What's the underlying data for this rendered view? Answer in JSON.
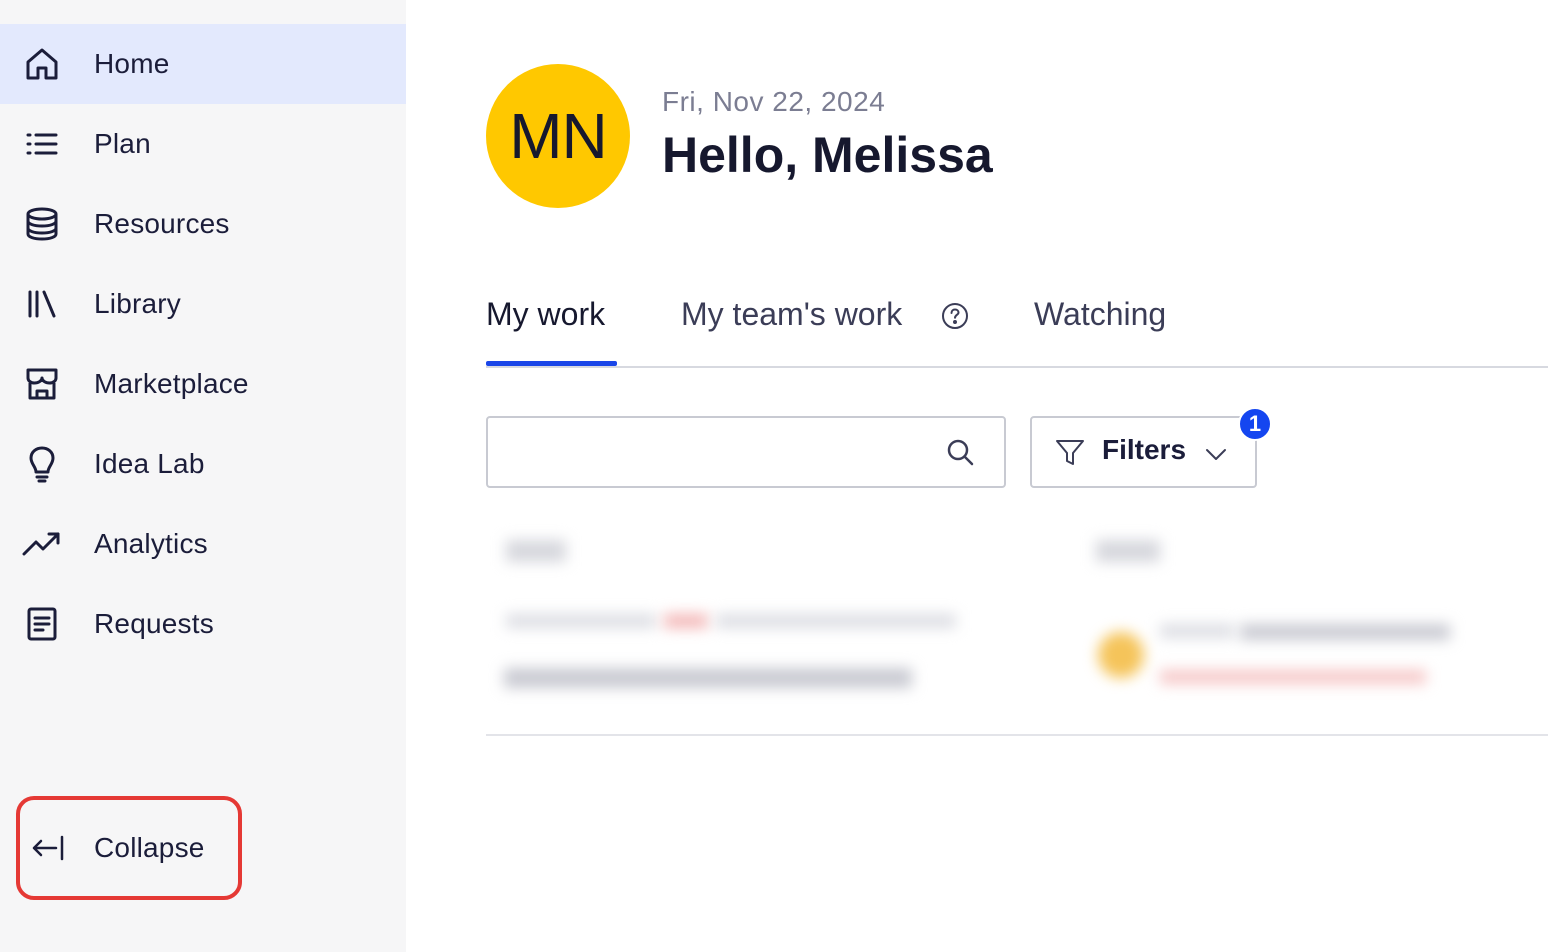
{
  "sidebar": {
    "items": [
      {
        "label": "Home",
        "icon": "home-icon",
        "active": true
      },
      {
        "label": "Plan",
        "icon": "list-icon",
        "active": false
      },
      {
        "label": "Resources",
        "icon": "database-icon",
        "active": false
      },
      {
        "label": "Library",
        "icon": "library-icon",
        "active": false
      },
      {
        "label": "Marketplace",
        "icon": "store-icon",
        "active": false
      },
      {
        "label": "Idea Lab",
        "icon": "lightbulb-icon",
        "active": false
      },
      {
        "label": "Analytics",
        "icon": "trend-up-icon",
        "active": false
      },
      {
        "label": "Requests",
        "icon": "document-icon",
        "active": false
      }
    ],
    "collapse_label": "Collapse"
  },
  "user": {
    "initials": "MN",
    "date": "Fri, Nov 22, 2024",
    "greeting": "Hello, Melissa",
    "avatar_color": "#ffc800"
  },
  "tabs": [
    {
      "label": "My work",
      "active": true
    },
    {
      "label": "My team's work",
      "active": false
    },
    {
      "label": "Watching",
      "active": false
    }
  ],
  "search": {
    "placeholder": "",
    "value": ""
  },
  "filters": {
    "label": "Filters",
    "count": "1"
  },
  "colors": {
    "accent": "#1a46e8",
    "active_nav_bg": "#e3e9fd",
    "highlight_border": "#e53935"
  }
}
